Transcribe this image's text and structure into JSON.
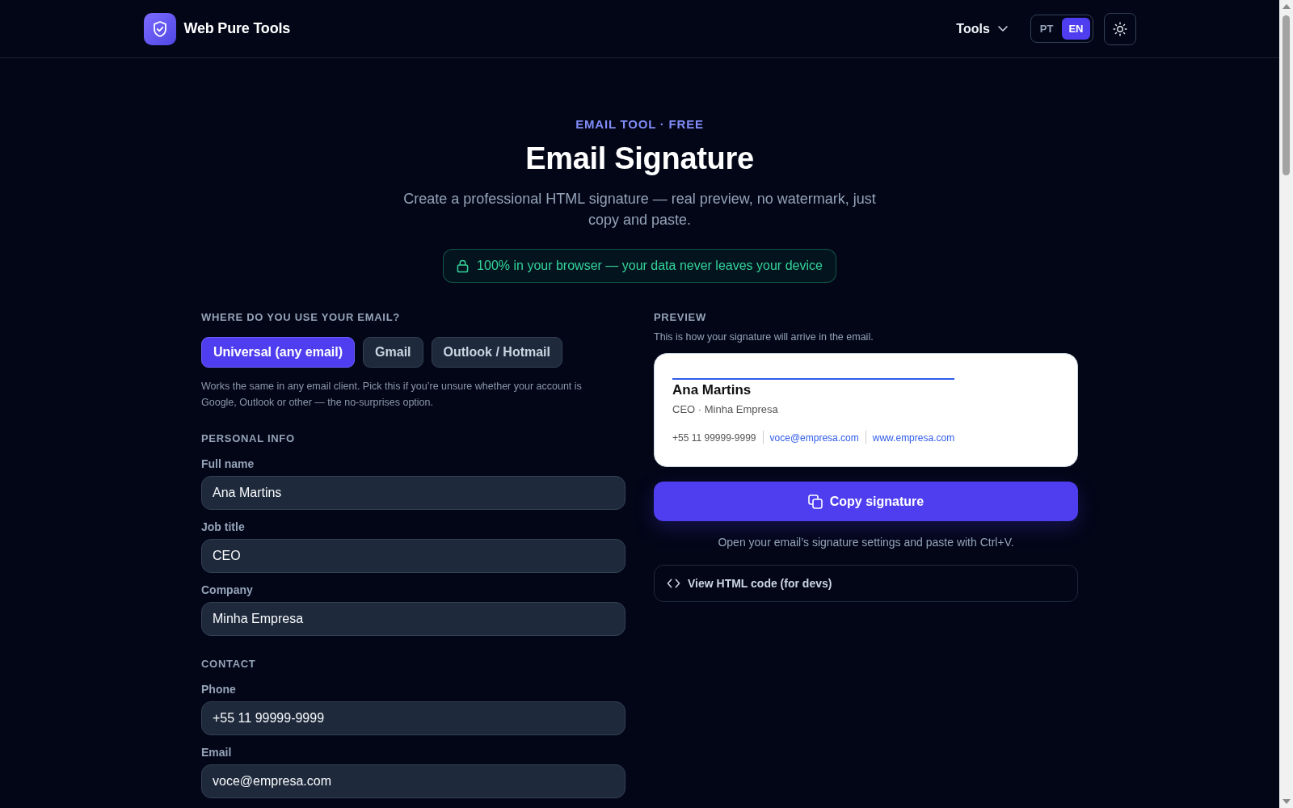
{
  "header": {
    "brand": "Web Pure Tools",
    "menu_label": "Tools",
    "languages": [
      {
        "label": "PT",
        "selected": false
      },
      {
        "label": "EN",
        "selected": true
      }
    ]
  },
  "hero": {
    "eyebrow": "EMAIL TOOL · FREE",
    "title": "Email Signature",
    "subtitle": "Create a professional HTML signature — real preview, no watermark, just copy and paste.",
    "privacy_badge": "100% in your browser — your data never leaves your device"
  },
  "client_picker": {
    "heading": "WHERE DO YOU USE YOUR EMAIL?",
    "options": [
      {
        "label": "Universal (any email)",
        "selected": true
      },
      {
        "label": "Gmail",
        "selected": false
      },
      {
        "label": "Outlook / Hotmail",
        "selected": false
      }
    ],
    "help": "Works the same in any email client. Pick this if you’re unsure whether your account is Google, Outlook or other — the no-surprises option."
  },
  "sections": [
    {
      "heading": "PERSONAL INFO",
      "fields": [
        {
          "label": "Full name",
          "value": "Ana Martins"
        },
        {
          "label": "Job title",
          "value": "CEO"
        },
        {
          "label": "Company",
          "value": "Minha Empresa"
        }
      ]
    },
    {
      "heading": "CONTACT",
      "fields": [
        {
          "label": "Phone",
          "value": "+55 11 99999-9999"
        },
        {
          "label": "Email",
          "value": "voce@empresa.com"
        }
      ]
    }
  ],
  "preview": {
    "heading": "PREVIEW",
    "caption": "This is how your signature will arrive in the email.",
    "signature": {
      "name": "Ana Martins",
      "role_line": "CEO · Minha Empresa",
      "contacts": [
        {
          "kind": "text",
          "text": "+55 11 99999-9999"
        },
        {
          "kind": "link",
          "text": "voce@empresa.com"
        },
        {
          "kind": "link",
          "text": "www.empresa.com"
        }
      ]
    },
    "copy_button": "Copy signature",
    "hint": "Open your email’s signature settings and paste with Ctrl+V.",
    "code_toggle": "View HTML code (for devs)"
  }
}
